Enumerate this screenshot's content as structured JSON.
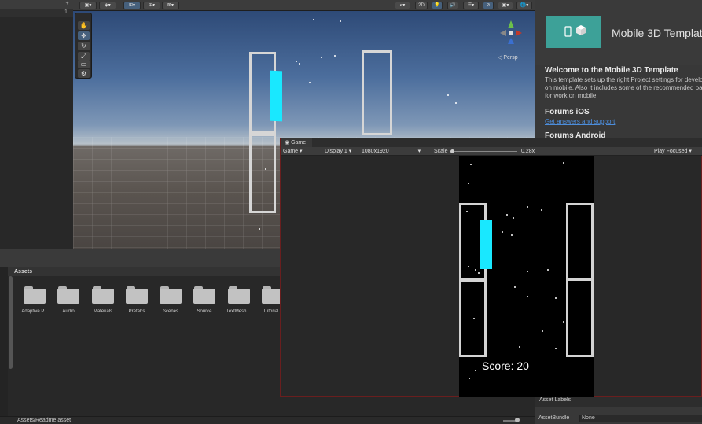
{
  "hierarchy": {
    "badge": "+",
    "row_count": "1"
  },
  "scene_toolbar": {
    "buttons": [
      "▣▾",
      "◈▾",
      "⊞▾",
      "⊕▾",
      "⊠▾"
    ],
    "right_buttons": [
      "◐▾",
      "2D",
      "💡",
      "🔊",
      "☰▾",
      "⊘",
      "▣▾",
      "🌐▾"
    ]
  },
  "scene": {
    "tools": [
      "✋",
      "✥",
      "↻",
      "⤢",
      "▭",
      "⚙"
    ],
    "persp_label": "◁ Persp"
  },
  "inspector": {
    "template_title": "Mobile 3D Template",
    "welcome_title": "Welcome to the Mobile 3D Template",
    "welcome_body": "This template sets up the right Project settings for development on mobile. Also it includes some of the recommended packages for work on mobile.",
    "forums_title": "Forums iOS",
    "forums_link": "Get answers and support",
    "forums_android": "Forums Android",
    "asset_labels": "Asset Labels",
    "asset_bundle_label": "AssetBundle",
    "asset_bundle_value": "None"
  },
  "project": {
    "path": "Assets",
    "folders": [
      "Adaptive P...",
      "Audio",
      "Materials",
      "Prefabs",
      "Scenes",
      "Source",
      "TextMesh ...",
      "Tutorial..."
    ],
    "status_path": "Assets/Readme.asset"
  },
  "game": {
    "tab_label": "Game",
    "view_dropdown": "Game",
    "display": "Display 1",
    "resolution": "1080x1920",
    "scale_label": "Scale",
    "scale_value": "0.28x",
    "play_mode": "Play Focused",
    "score_text": "Score: 20"
  },
  "colors": {
    "accent": "#46607c",
    "bird": "#19e8ff",
    "logo": "#3da198",
    "link": "#4c8ddb",
    "game_border": "#6a1e1e"
  }
}
